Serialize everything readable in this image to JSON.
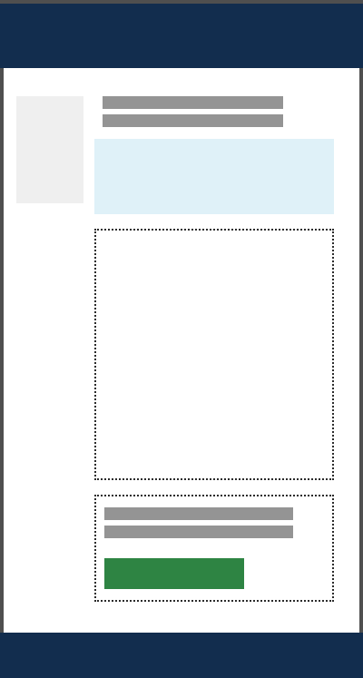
{
  "theme": {
    "header_color": "#122d4e",
    "frame_color": "#4f4f4f",
    "content_background": "#ffffff",
    "thumbnail_color": "#efefef",
    "placeholder_line_color": "#949494",
    "banner_color": "#dff1f8",
    "button_color": "#2e8443",
    "dotted_border_color": "#2b2b2b"
  },
  "header": {
    "title": ""
  },
  "main": {
    "banner_text": "",
    "action_button_label": ""
  },
  "footer": {
    "text": ""
  }
}
